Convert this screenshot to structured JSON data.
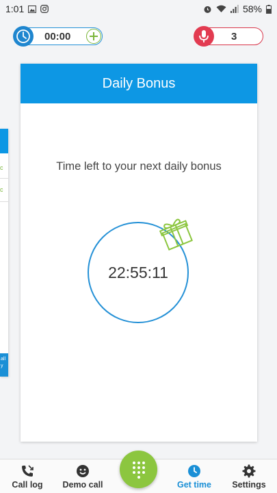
{
  "status_bar": {
    "time": "1:01",
    "battery": "58%"
  },
  "timer": {
    "value": "00:00",
    "clock_icon": "clock-icon",
    "add_icon": "plus-icon"
  },
  "recordings": {
    "count": "3",
    "mic_icon": "microphone-icon"
  },
  "card": {
    "title": "Daily Bonus",
    "subtitle": "Time left to your next daily bonus",
    "countdown": "22:55:11"
  },
  "nav": {
    "call_log": "Call log",
    "demo_call": "Demo call",
    "get_time": "Get time",
    "settings": "Settings"
  },
  "colors": {
    "accent_blue": "#0d97e4",
    "accent_green": "#8cc63f",
    "accent_red": "#e23b51"
  }
}
